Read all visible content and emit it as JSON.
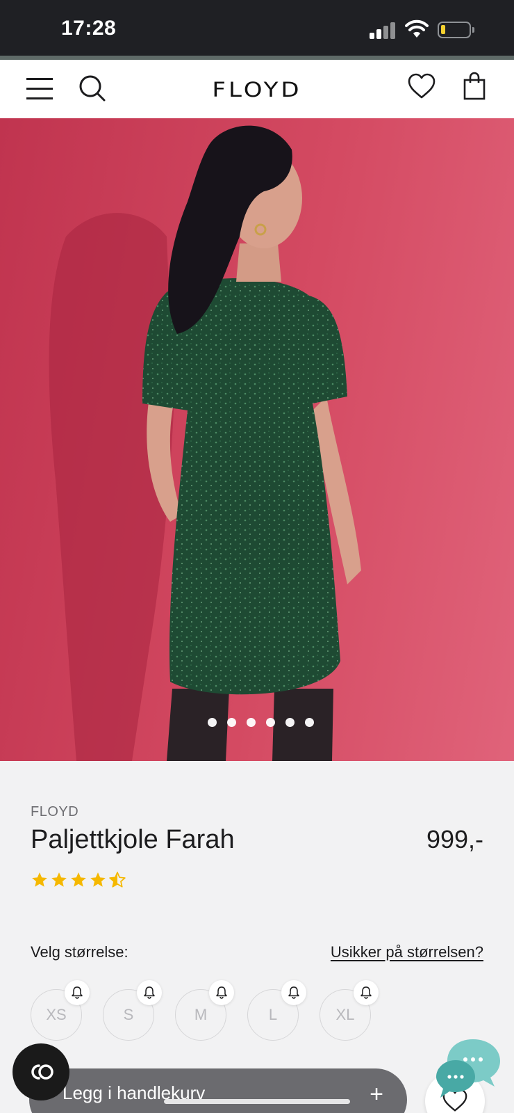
{
  "status_bar": {
    "time": "17:28",
    "icons": [
      "cellular-signal-icon",
      "wifi-icon",
      "battery-icon"
    ],
    "battery_level": 0.12
  },
  "header": {
    "logo": "FLOYD",
    "icons": [
      "menu-icon",
      "search-icon",
      "heart-icon",
      "bag-icon"
    ]
  },
  "gallery": {
    "image_count": 6,
    "active_index": 0
  },
  "product": {
    "brand": "FLOYD",
    "name": "Paljettkjole Farah",
    "price": "999,-",
    "rating": 4.5,
    "rating_max": 5
  },
  "size_selector": {
    "label": "Velg størrelse:",
    "help_link": "Usikker på størrelsen?",
    "sizes": [
      "XS",
      "S",
      "M",
      "L",
      "XL"
    ]
  },
  "actions": {
    "add_to_cart": "Legg i handlekurv"
  },
  "colors": {
    "hero_background": "#cf4560",
    "star": "#f5b800",
    "cart_button": "#6b6b6f",
    "chat": "#6fc7c2"
  }
}
